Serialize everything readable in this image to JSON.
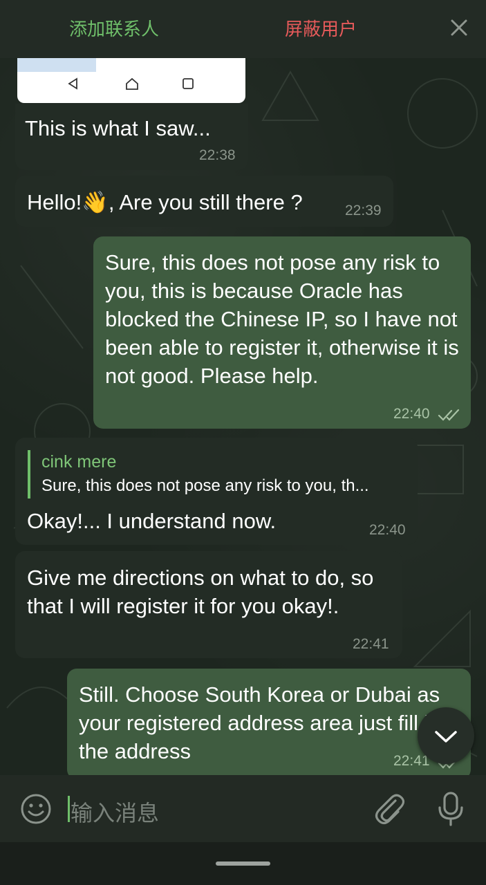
{
  "header": {
    "add_contact": "添加联系人",
    "block_user": "屏蔽用户"
  },
  "messages": [
    {
      "type": "in",
      "text": "This is what I saw...",
      "time": "22:38"
    },
    {
      "type": "in",
      "text": "Hello!👋, Are you still there ?",
      "time": "22:39"
    },
    {
      "type": "out",
      "text": "Sure, this does not pose any risk to you, this is because Oracle has blocked the Chinese IP, so I have not been able to register it, otherwise it is not good. Please help.",
      "time": "22:40"
    },
    {
      "type": "in",
      "reply_name": "cink mere",
      "reply_text": "Sure, this does not pose any risk to you, th...",
      "text": "Okay!... I understand now.",
      "time": "22:40"
    },
    {
      "type": "in",
      "text": "Give me directions on what to do, so that I will register it for you okay!.",
      "time": "22:41"
    },
    {
      "type": "out",
      "text": "Still.  Choose South Korea or Dubai as your registered address area just fill in the address",
      "time": "22:41"
    }
  ],
  "composer": {
    "placeholder": "输入消息"
  },
  "colors": {
    "accent": "#6fbf6a",
    "danger": "#e65a5a",
    "outgoing_bubble": "#3f5c40",
    "incoming_bubble": "#232c25"
  },
  "icons": [
    "close-icon",
    "emoji-icon",
    "attach-icon",
    "microphone-icon",
    "chevron-down-icon",
    "double-check-icon"
  ]
}
